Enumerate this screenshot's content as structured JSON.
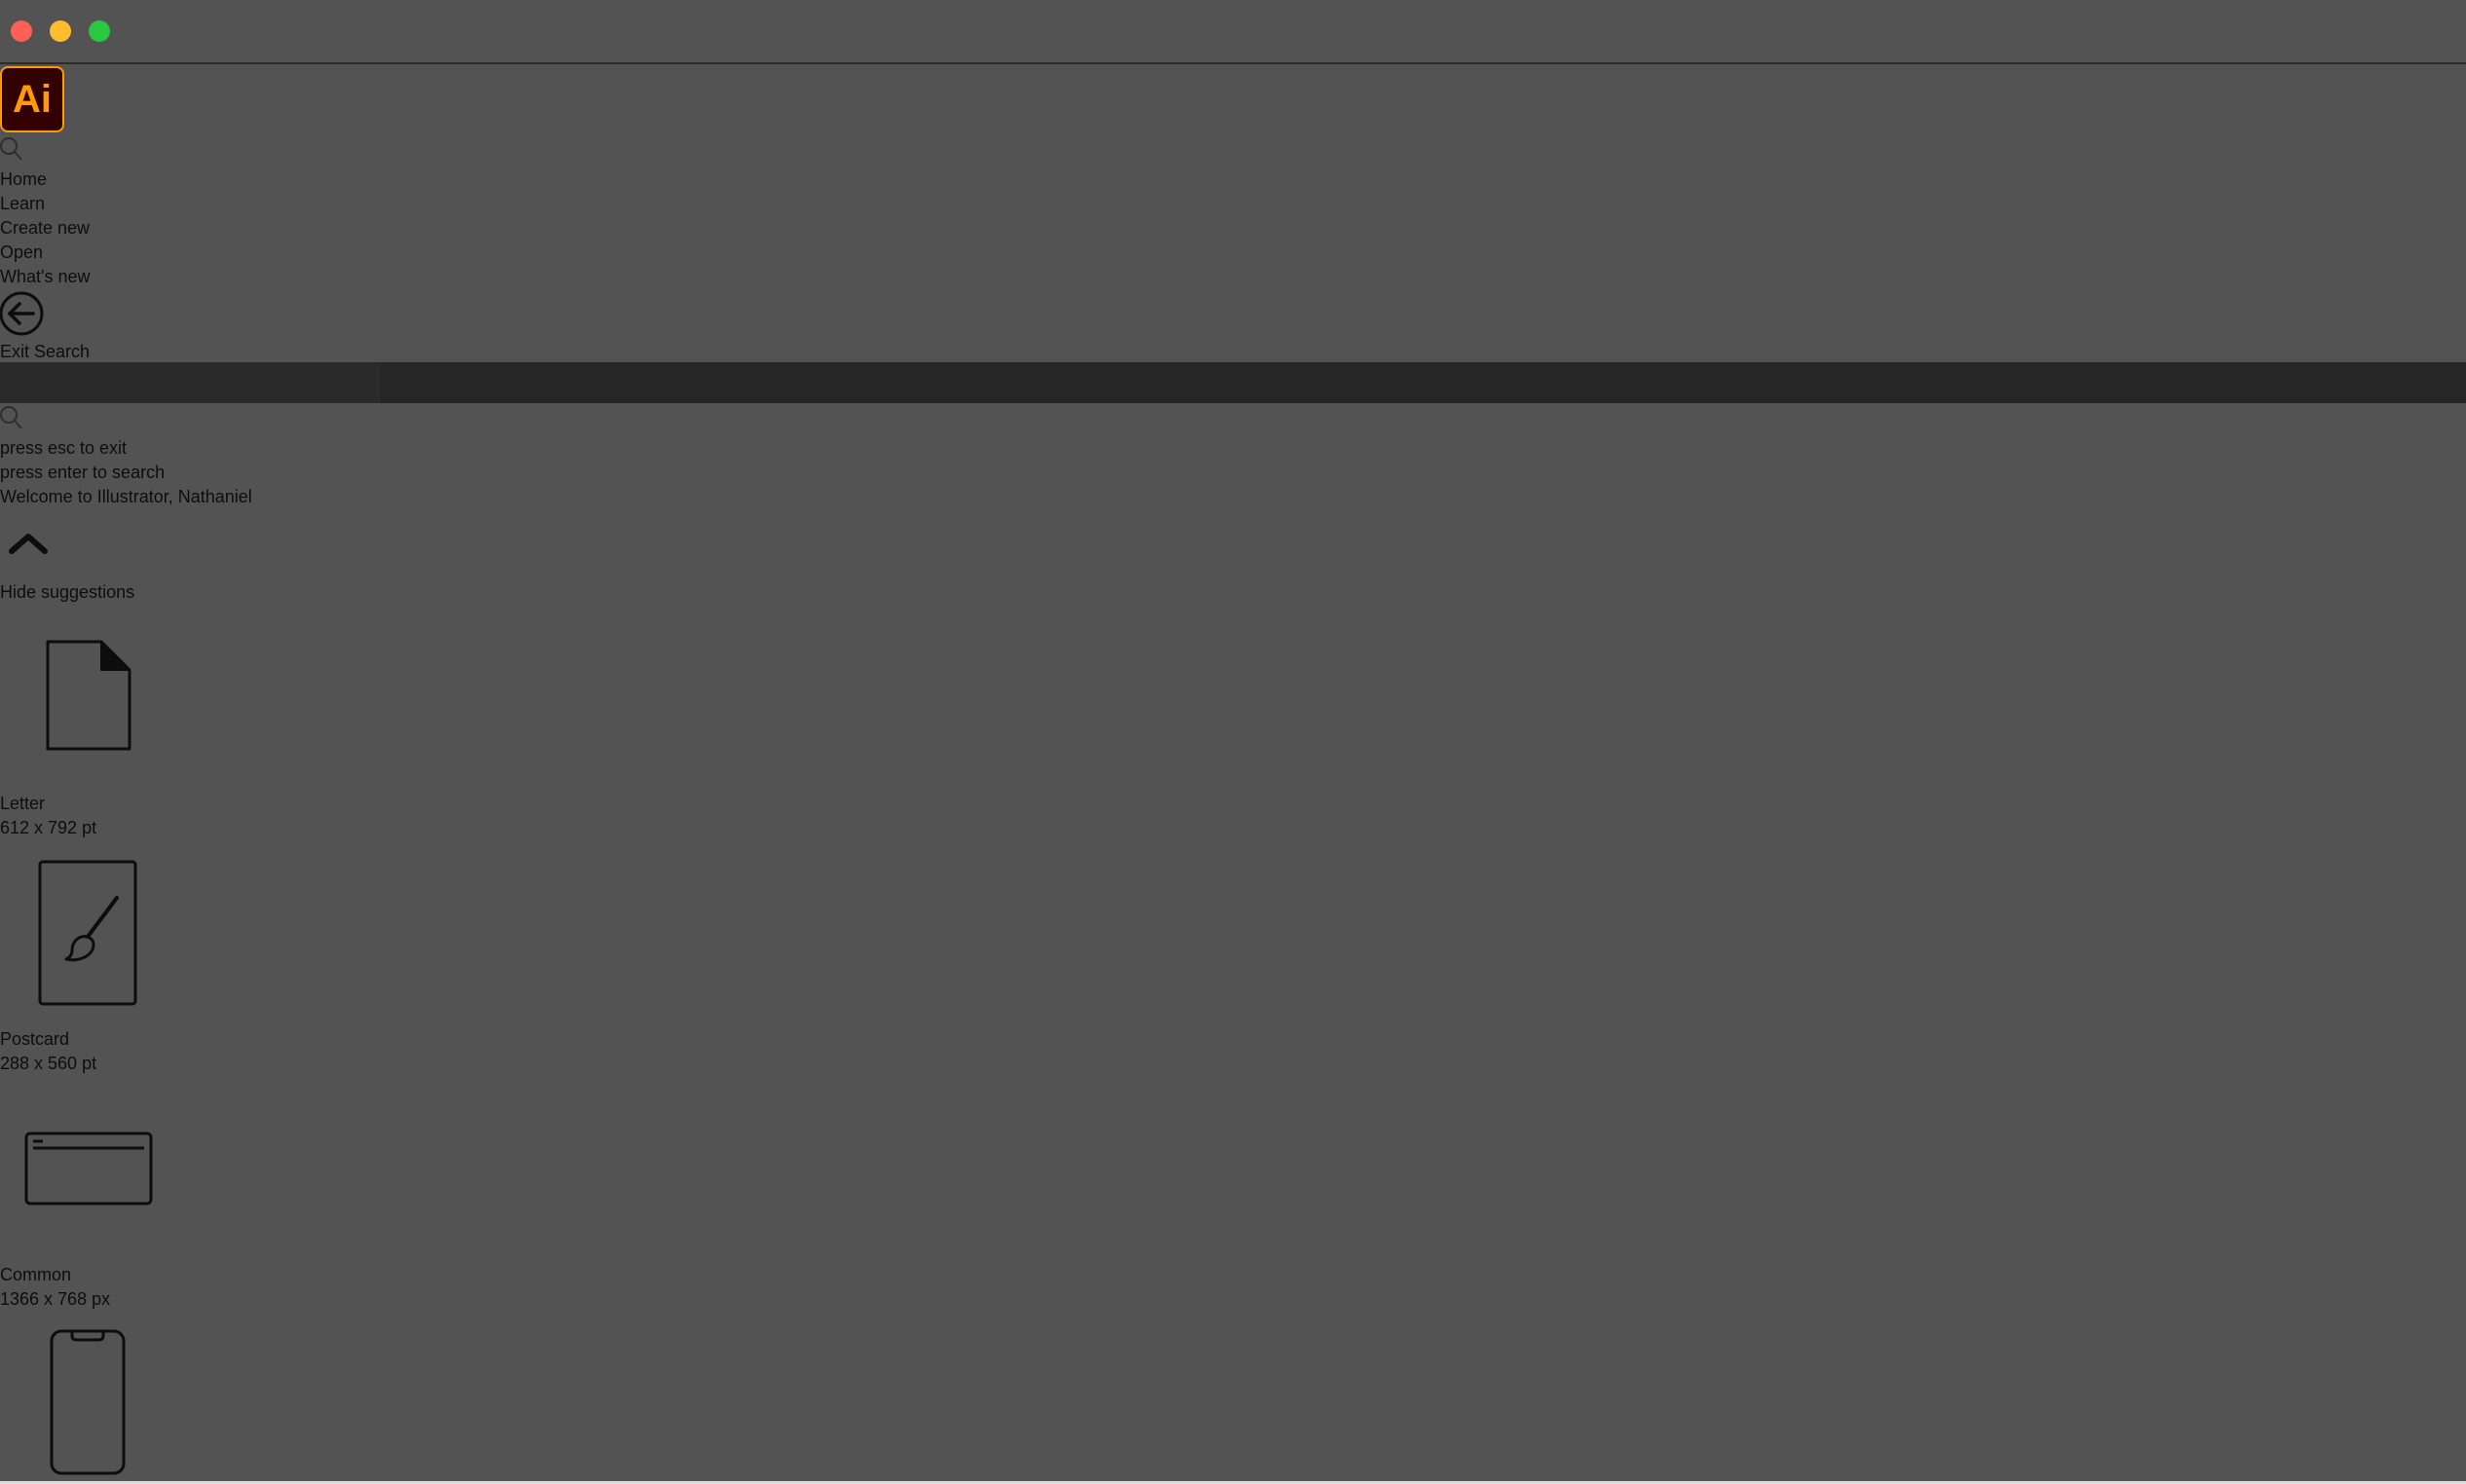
{
  "window": {
    "controls": [
      "close",
      "minimize",
      "maximize"
    ]
  },
  "app": {
    "logo_text": "Ai",
    "logo_color": "#ff9a00",
    "logo_bg": "#330000"
  },
  "nav": {
    "search_icon": "search-icon",
    "items": [
      {
        "label": "Home"
      },
      {
        "label": "Learn"
      },
      {
        "label": "Create new"
      },
      {
        "label": "Open"
      },
      {
        "label": "What's new"
      }
    ],
    "exit_search_label": "Exit Search",
    "exit_icon": "arrow-left-circle-icon"
  },
  "search": {
    "hint_exit": "press esc to exit",
    "hint_search": "press enter to search"
  },
  "welcome": {
    "title": "Welcome to Illustrator, Nathaniel",
    "hide_suggestions_label": "Hide suggestions",
    "toggle_icon": "chevron-up-icon"
  },
  "presets": [
    {
      "name": "Letter",
      "size": "612 x 792 pt",
      "icon": "document-icon"
    },
    {
      "name": "Postcard",
      "size": "288 x 560 pt",
      "icon": "brush-card-icon"
    },
    {
      "name": "Common",
      "size": "1366 x 768 px",
      "icon": "browser-window-icon"
    },
    {
      "name": "",
      "size": "",
      "icon": "phone-icon"
    }
  ],
  "colors": {
    "background": "#535353",
    "search_band": "#262626",
    "text": "#0d0d0d"
  }
}
